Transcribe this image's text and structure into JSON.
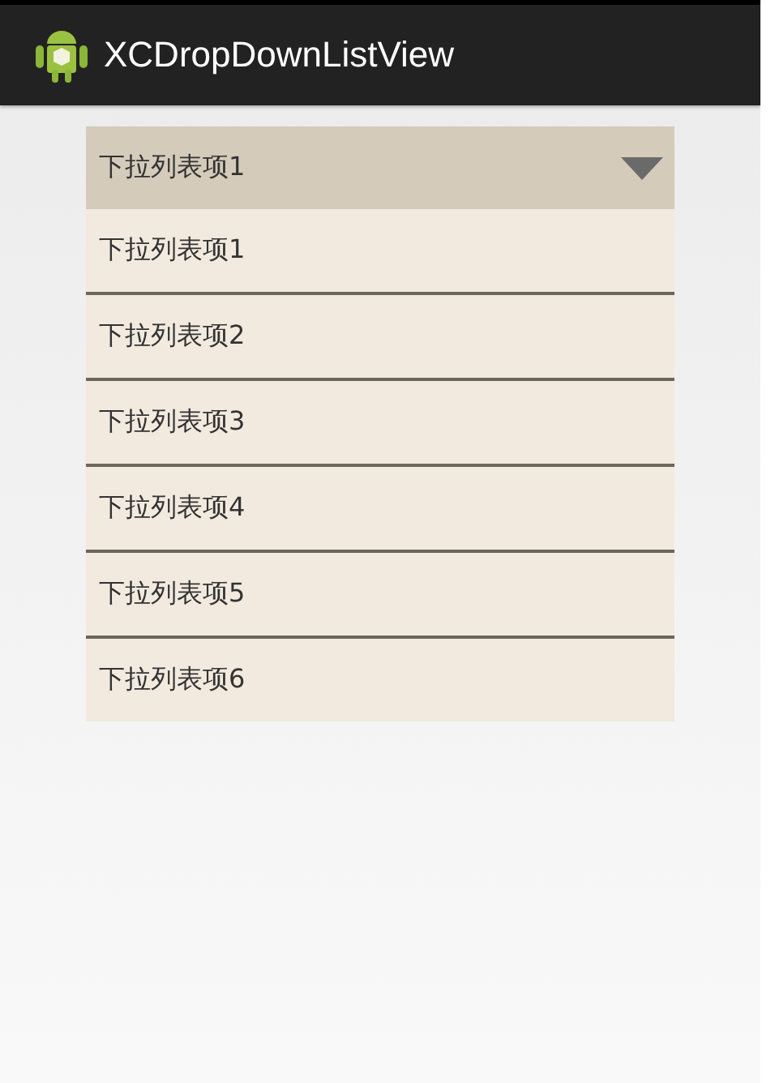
{
  "action_bar": {
    "title": "XCDropDownListView"
  },
  "dropdown": {
    "value": "下拉列表项1",
    "expanded": true,
    "items": [
      "下拉列表项1",
      "下拉列表项2",
      "下拉列表项3",
      "下拉列表项4",
      "下拉列表项5",
      "下拉列表项6"
    ]
  }
}
